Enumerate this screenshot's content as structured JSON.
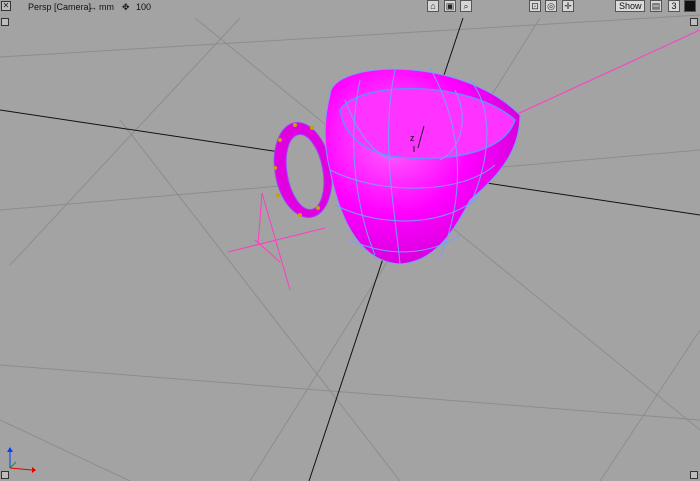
{
  "toolbar": {
    "view_label": "Persp [Camera]",
    "units_label": "mm",
    "zoom_value": "100",
    "show_button": "Show",
    "layout_number": "3"
  },
  "axis_labels": {
    "z": "z"
  },
  "icons": {
    "corner": "viewport-corner-icon",
    "units": "move-arrows-icon",
    "zoom": "zoom-icon",
    "camera": "camera-icon",
    "film": "film-icon",
    "magnify": "magnify-icon",
    "bounds": "bounding-box-icon",
    "target": "target-icon",
    "move": "move-icon",
    "frame": "frame-icon",
    "color": "color-square-icon"
  },
  "colors": {
    "background": "#a3a3a3",
    "grid": "#8f8f8f",
    "axis": "#000000",
    "object": "#ff00ff",
    "wire": "#6b8cff"
  }
}
